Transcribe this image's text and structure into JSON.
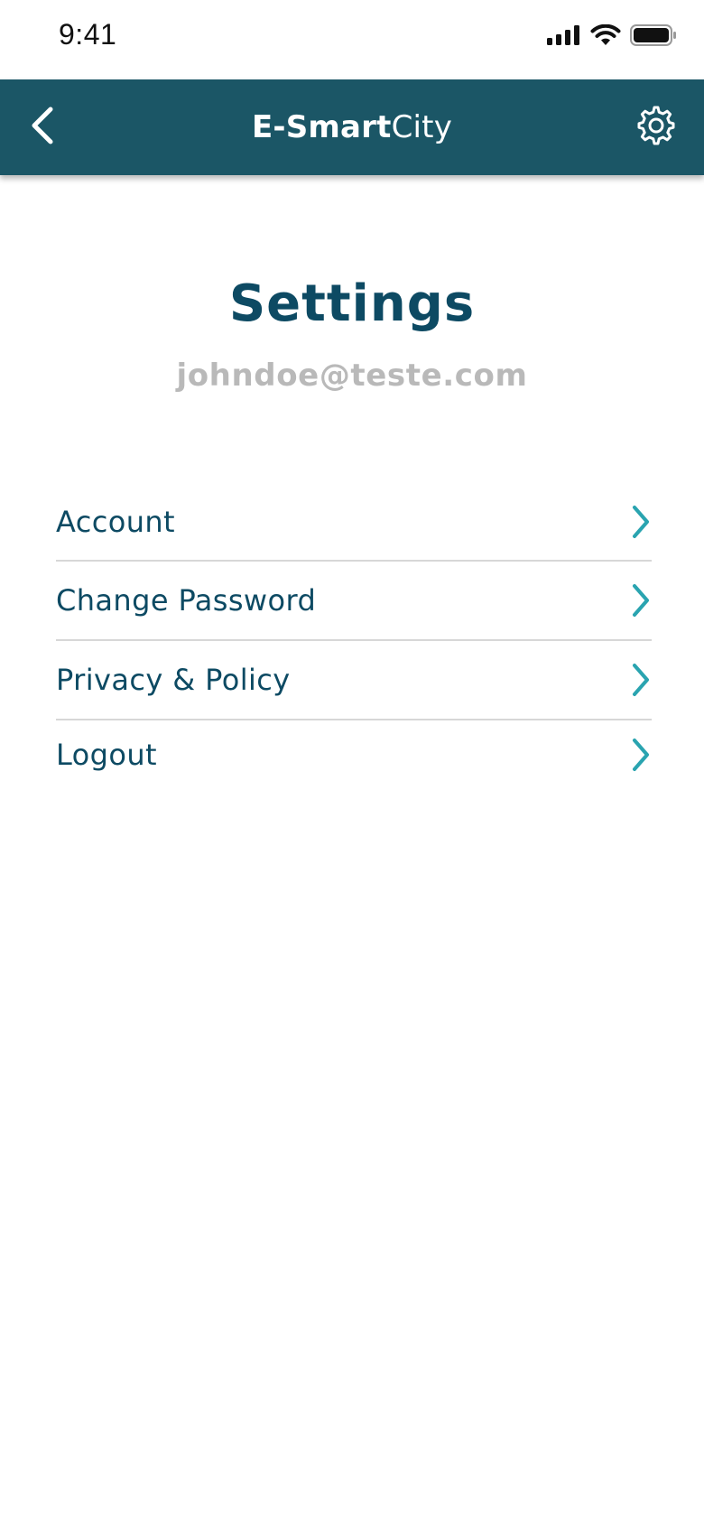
{
  "status_bar": {
    "time": "9:41"
  },
  "header": {
    "brand_strong": "E-Smart",
    "brand_light": "City",
    "back_icon": "chevron-left-icon",
    "settings_icon": "gear-icon",
    "background_color": "#1b5666"
  },
  "page": {
    "title": "Settings",
    "email": "johndoe@teste.com"
  },
  "menu": {
    "items": [
      {
        "label": "Account",
        "icon": "chevron-right-icon"
      },
      {
        "label": "Change Password",
        "icon": "chevron-right-icon"
      },
      {
        "label": "Privacy & Policy",
        "icon": "chevron-right-icon"
      },
      {
        "label": "Logout",
        "icon": "chevron-right-icon"
      }
    ]
  },
  "colors": {
    "primary_text": "#0d4a63",
    "chevron": "#2aa4b0",
    "email_text": "#b9b9b9",
    "divider": "#d7d7d7"
  }
}
